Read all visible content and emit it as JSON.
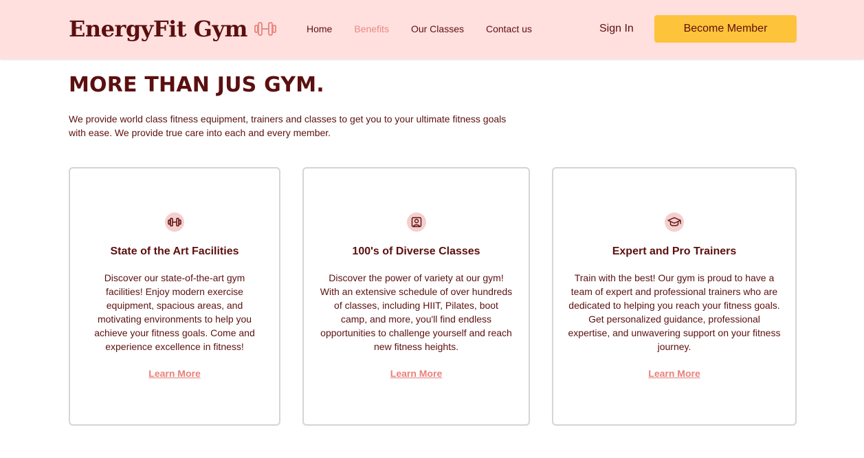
{
  "brand": {
    "name": "EnergyFit Gym",
    "icon": "dumbbell-icon"
  },
  "nav": {
    "links": [
      {
        "label": "Home"
      },
      {
        "label": "Benefits",
        "active": true
      },
      {
        "label": "Our Classes"
      },
      {
        "label": "Contact us"
      }
    ],
    "signin_label": "Sign In",
    "cta_label": "Become Member"
  },
  "hero": {
    "title": "MORE THAN JUS GYM.",
    "intro": "We provide world class fitness equipment, trainers and classes to get you to your ultimate fitness goals with ease. We provide true care into each and every member."
  },
  "benefits": [
    {
      "icon": "dumbbell-icon",
      "title": "State of the Art Facilities",
      "description": "Discover our state-of-the-art gym facilities! Enjoy modern exercise equipment, spacious areas, and motivating environments to help you achieve your fitness goals. Come and experience excellence in fitness!",
      "link": "Learn More"
    },
    {
      "icon": "user-portrait-icon",
      "title": "100's of Diverse Classes",
      "description": "Discover the power of variety at our gym! With an extensive schedule of over hundreds of classes, including HIIT, Pilates, boot camp, and more, you'll find endless opportunities to challenge yourself and reach new fitness heights.",
      "link": "Learn More"
    },
    {
      "icon": "graduation-cap-icon",
      "title": "Expert and Pro Trainers",
      "description": "Train with the best! Our gym is proud to have a team of expert and professional trainers who are dedicated to helping you reach your fitness goals. Get personalized guidance, professional expertise, and unwavering support on your fitness journey.",
      "link": "Learn More"
    }
  ],
  "colors": {
    "primary": "#5c0f0f",
    "accent": "#e98a83",
    "nav_bg": "#ffe0df",
    "cta_bg": "#fdc33b",
    "icon_bg": "#f4cfcd"
  }
}
